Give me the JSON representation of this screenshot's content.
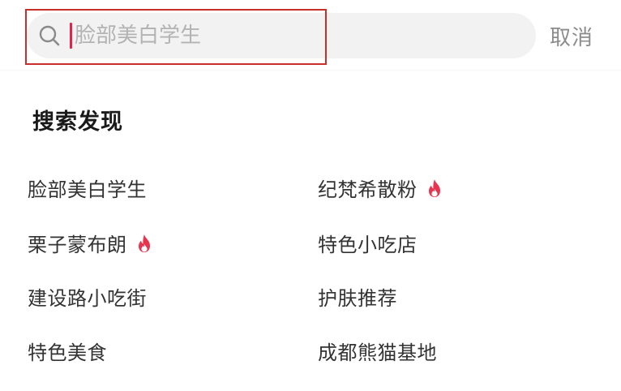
{
  "search": {
    "placeholder": "脸部美白学生",
    "cancel_label": "取消"
  },
  "discover": {
    "title": "搜索发现",
    "items": [
      {
        "label": "脸部美白学生",
        "hot": false
      },
      {
        "label": "纪梵希散粉",
        "hot": true
      },
      {
        "label": "栗子蒙布朗",
        "hot": true
      },
      {
        "label": "特色小吃店",
        "hot": false
      },
      {
        "label": "建设路小吃街",
        "hot": false
      },
      {
        "label": "护肤推荐",
        "hot": false
      },
      {
        "label": "特色美食",
        "hot": false
      },
      {
        "label": "成都熊猫基地",
        "hot": false
      }
    ]
  },
  "colors": {
    "highlight_border": "#c9302c",
    "hot_icon": "#e8344e",
    "cursor": "#e0244a"
  },
  "icons": {
    "search": "search-icon",
    "hot": "fire-icon"
  }
}
